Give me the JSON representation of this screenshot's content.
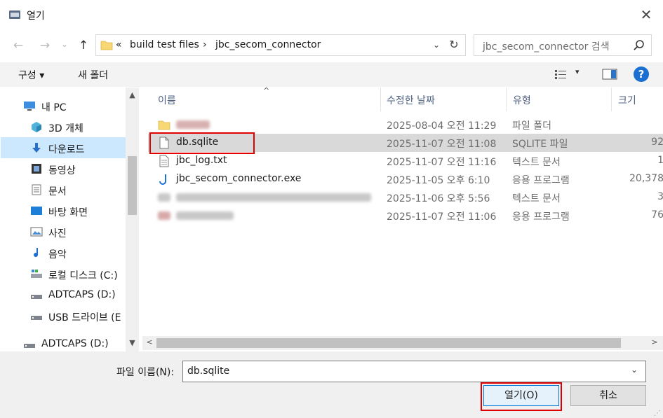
{
  "window": {
    "title": "열기",
    "close_label": "✕"
  },
  "nav": {
    "back": "←",
    "forward": "→",
    "recent": "⌄",
    "up": "↑"
  },
  "address": {
    "prefix": "«",
    "crumbs": [
      "build test files",
      "jbc_secom_connector"
    ],
    "separator": "›",
    "dropdown": "⌄",
    "refresh": "↻"
  },
  "search": {
    "placeholder": "jbc_secom_connector 검색"
  },
  "toolbar": {
    "organize_label": "구성 ▾",
    "new_folder_label": "새 폴더",
    "view_chev": "▾",
    "help_label": "?"
  },
  "sidebar": {
    "items": [
      {
        "label": "내 PC",
        "icon": "pc-icon"
      },
      {
        "label": "3D 개체",
        "icon": "cube-icon"
      },
      {
        "label": "다운로드",
        "icon": "download-icon",
        "selected": true
      },
      {
        "label": "동영상",
        "icon": "video-icon"
      },
      {
        "label": "문서",
        "icon": "document-icon"
      },
      {
        "label": "바탕 화면",
        "icon": "desktop-icon"
      },
      {
        "label": "사진",
        "icon": "picture-icon"
      },
      {
        "label": "음악",
        "icon": "music-icon"
      },
      {
        "label": "로컬 디스크 (C:)",
        "icon": "local-disk-icon"
      },
      {
        "label": "ADTCAPS (D:)",
        "icon": "drive-icon"
      },
      {
        "label": "USB 드라이브 (E",
        "icon": "usb-drive-icon"
      },
      {
        "label": "ADTCAPS (D:)",
        "icon": "drive-icon"
      }
    ],
    "scroll_up": "▲",
    "scroll_down": "▼"
  },
  "files": {
    "columns": [
      "이름",
      "수정한 날짜",
      "유형",
      "크기"
    ],
    "sort_caret": "^",
    "rows": [
      {
        "name": "",
        "date": "2025-08-04 오전 11:29",
        "type": "파일 폴더",
        "size": "",
        "icon": "folder-icon",
        "blurred": true
      },
      {
        "name": "db.sqlite",
        "date": "2025-11-07 오전 11:08",
        "type": "SQLITE 파일",
        "size": "92",
        "icon": "file-icon",
        "selected": true
      },
      {
        "name": "jbc_log.txt",
        "date": "2025-11-07 오전 11:16",
        "type": "텍스트 문서",
        "size": "1",
        "icon": "text-file-icon"
      },
      {
        "name": "jbc_secom_connector.exe",
        "date": "2025-11-05 오후 6:10",
        "type": "응용 프로그램",
        "size": "20,378",
        "icon": "exe-icon"
      },
      {
        "name": "",
        "date": "2025-11-06 오후 5:56",
        "type": "텍스트 문서",
        "size": "3",
        "icon": "blurred-icon",
        "blurred": true
      },
      {
        "name": "",
        "date": "2025-11-07 오전 11:06",
        "type": "응용 프로그램",
        "size": "76",
        "icon": "blurred-icon",
        "blurred": true
      }
    ],
    "hscroll_left": "<",
    "hscroll_right": ">"
  },
  "footer": {
    "filename_label": "파일 이름(N):",
    "filename_value": "db.sqlite",
    "filename_chev": "⌄",
    "open_label": "열기(O)",
    "cancel_label": "취소"
  }
}
